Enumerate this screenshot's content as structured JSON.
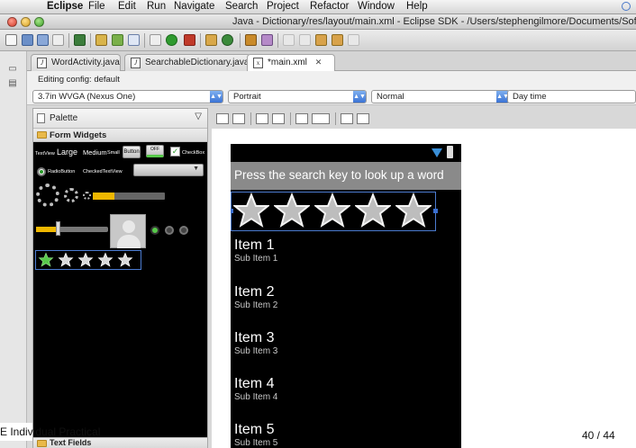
{
  "menubar": {
    "items": [
      "Eclipse",
      "File",
      "Edit",
      "Run",
      "Navigate",
      "Search",
      "Project",
      "Refactor",
      "Window",
      "Help"
    ]
  },
  "window": {
    "title": "Java - Dictionary/res/layout/main.xml - Eclipse SDK - /Users/stephengilmore/Documents/Softw"
  },
  "tabs": [
    {
      "label": "WordActivity.java",
      "icon": "java-file-icon"
    },
    {
      "label": "SearchableDictionary.java",
      "icon": "java-file-icon"
    },
    {
      "label": "*main.xml",
      "icon": "xml-file-icon",
      "close": "✕"
    }
  ],
  "config": {
    "label": "Editing config:  default",
    "device": "3.7in WVGA (Nexus One)",
    "orientation": "Portrait",
    "dock": "Normal",
    "night": "Day time"
  },
  "palette": {
    "title": "Palette",
    "group": "Form Widgets",
    "next_group": "Text Fields",
    "widgets": {
      "textview": "TextView",
      "large": "Large",
      "medium": "Medium",
      "small": "Small",
      "button": "Button",
      "toggle": "OFF",
      "checkbox": "CheckBox",
      "radio": "RadioButton",
      "checked_text": "CheckedTextView"
    }
  },
  "device": {
    "search_hint": "Press the search key to look up a word",
    "rating": 5,
    "items": [
      {
        "title": "Item 1",
        "sub": "Sub Item 1"
      },
      {
        "title": "Item 2",
        "sub": "Sub Item 2"
      },
      {
        "title": "Item 3",
        "sub": "Sub Item 3"
      },
      {
        "title": "Item 4",
        "sub": "Sub Item 4"
      },
      {
        "title": "Item 5",
        "sub": "Sub Item 5"
      }
    ]
  },
  "footer": {
    "left": "E Individual Practical",
    "page": "40 / 44"
  },
  "colors": {
    "accent": "#3b73d4",
    "toggle_green": "#57c94a"
  }
}
